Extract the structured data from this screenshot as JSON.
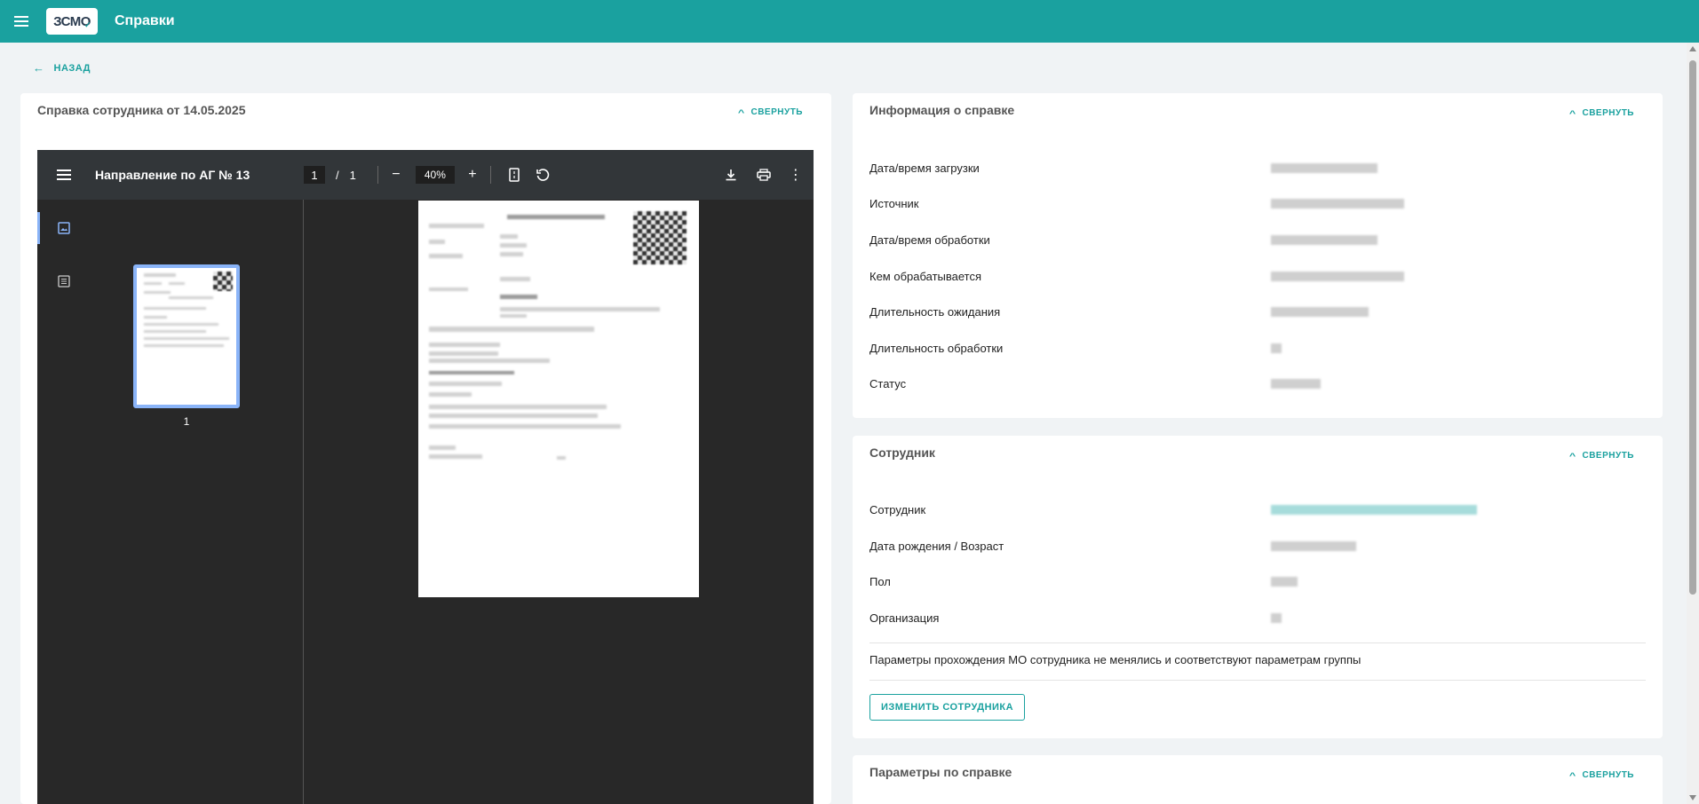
{
  "header": {
    "logo_text": "ЗСМО",
    "title": "Справки"
  },
  "back_label": "НАЗАД",
  "collapse_label": "СВЕРНУТЬ",
  "left": {
    "title": "Справка сотрудника от 14.05.2025",
    "viewer": {
      "doc_title": "Направление по АГ № 13",
      "page_current": "1",
      "page_sep": "/",
      "page_total": "1",
      "zoom": "40%",
      "thumb_page": "1"
    }
  },
  "info": {
    "title": "Информация о справке",
    "rows": [
      {
        "label": "Дата/время загрузки"
      },
      {
        "label": "Источник"
      },
      {
        "label": "Дата/время обработки"
      },
      {
        "label": "Кем обрабатывается"
      },
      {
        "label": "Длительность ожидания"
      },
      {
        "label": "Длительность обработки"
      },
      {
        "label": "Статус"
      }
    ]
  },
  "employee": {
    "title": "Сотрудник",
    "rows": [
      {
        "label": "Сотрудник"
      },
      {
        "label": "Дата рождения / Возраст"
      },
      {
        "label": "Пол"
      },
      {
        "label": "Организация"
      }
    ],
    "note": "Параметры прохождения МО сотрудника не менялись и соответствуют параметрам группы",
    "change_button": "ИЗМЕНИТЬ СОТРУДНИКА"
  },
  "params": {
    "title": "Параметры по справке"
  },
  "colors": {
    "accent": "#1aa19f",
    "viewer_bg": "#282828",
    "viewer_toolbar": "#323639",
    "page_bg": "#f0f3f5"
  }
}
